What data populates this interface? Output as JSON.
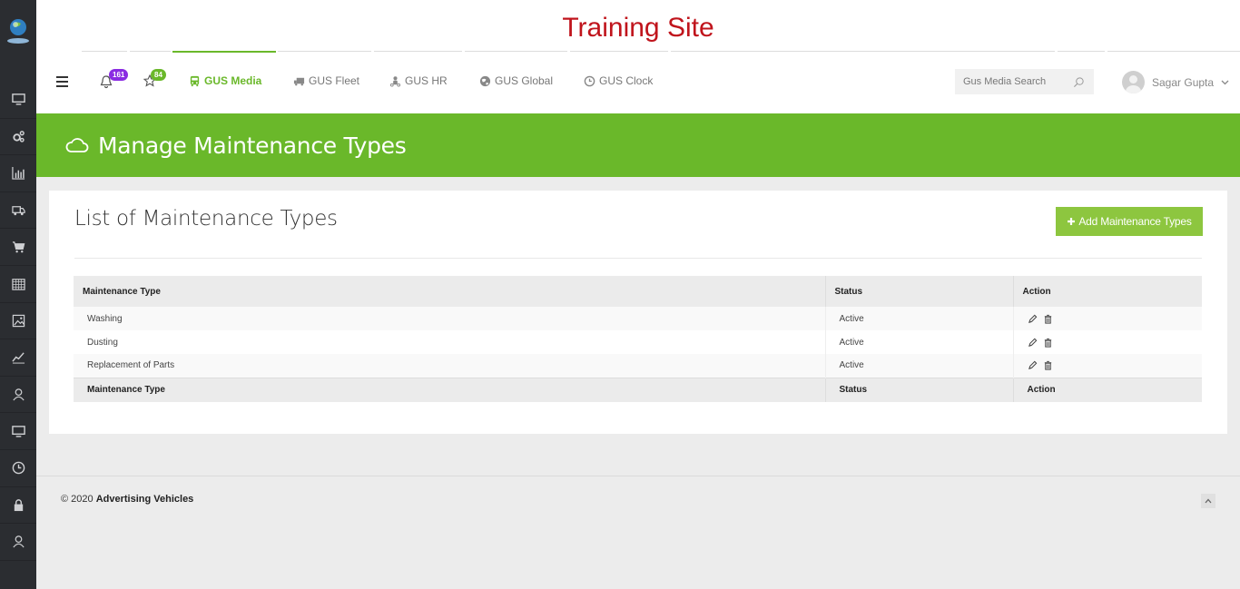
{
  "header": {
    "site_title": "Training Site"
  },
  "nav": {
    "notifications_count": "161",
    "favorites_count": "84",
    "items": [
      {
        "label": "GUS Media",
        "icon": "bus-icon",
        "active": true
      },
      {
        "label": "GUS Fleet",
        "icon": "truck-icon",
        "active": false
      },
      {
        "label": "GUS HR",
        "icon": "people-icon",
        "active": false
      },
      {
        "label": "GUS Global",
        "icon": "globe-icon",
        "active": false
      },
      {
        "label": "GUS Clock",
        "icon": "clock-icon",
        "active": false
      }
    ],
    "search_placeholder": "Gus Media Search",
    "user_name": "Sagar Gupta"
  },
  "sidebar": {
    "items": [
      "monitor-icon",
      "gears-icon",
      "bar-chart-icon",
      "truck-icon",
      "cart-icon",
      "calendar-icon",
      "image-icon",
      "line-chart-icon",
      "user-icon",
      "desktop-icon",
      "clock-icon",
      "lock-icon",
      "user-icon"
    ]
  },
  "page": {
    "title": "Manage Maintenance Types"
  },
  "panel": {
    "title": "List of Maintenance Types",
    "add_button": "Add Maintenance Types"
  },
  "table": {
    "headers": [
      "Maintenance Type",
      "Status",
      "Action"
    ],
    "rows": [
      {
        "type": "Washing",
        "status": "Active"
      },
      {
        "type": "Dusting",
        "status": "Active"
      },
      {
        "type": "Replacement of Parts",
        "status": "Active"
      }
    ],
    "footers": [
      "Maintenance Type",
      "Status",
      "Action"
    ]
  },
  "footer": {
    "copyright": "© 2020",
    "company": "Advertising Vehicles"
  },
  "colors": {
    "brand_green": "#6ab82a",
    "title_red": "#c0141c",
    "sidebar_dark": "#2b2d31"
  }
}
